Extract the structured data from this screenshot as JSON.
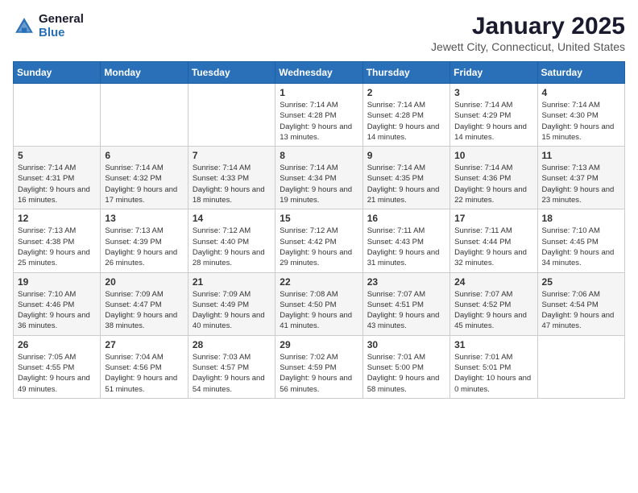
{
  "header": {
    "logo_general": "General",
    "logo_blue": "Blue",
    "month": "January 2025",
    "location": "Jewett City, Connecticut, United States"
  },
  "weekdays": [
    "Sunday",
    "Monday",
    "Tuesday",
    "Wednesday",
    "Thursday",
    "Friday",
    "Saturday"
  ],
  "weeks": [
    [
      null,
      null,
      null,
      {
        "day": "1",
        "sunrise": "7:14 AM",
        "sunset": "4:28 PM",
        "daylight": "9 hours and 13 minutes."
      },
      {
        "day": "2",
        "sunrise": "7:14 AM",
        "sunset": "4:28 PM",
        "daylight": "9 hours and 14 minutes."
      },
      {
        "day": "3",
        "sunrise": "7:14 AM",
        "sunset": "4:29 PM",
        "daylight": "9 hours and 14 minutes."
      },
      {
        "day": "4",
        "sunrise": "7:14 AM",
        "sunset": "4:30 PM",
        "daylight": "9 hours and 15 minutes."
      }
    ],
    [
      {
        "day": "5",
        "sunrise": "7:14 AM",
        "sunset": "4:31 PM",
        "daylight": "9 hours and 16 minutes."
      },
      {
        "day": "6",
        "sunrise": "7:14 AM",
        "sunset": "4:32 PM",
        "daylight": "9 hours and 17 minutes."
      },
      {
        "day": "7",
        "sunrise": "7:14 AM",
        "sunset": "4:33 PM",
        "daylight": "9 hours and 18 minutes."
      },
      {
        "day": "8",
        "sunrise": "7:14 AM",
        "sunset": "4:34 PM",
        "daylight": "9 hours and 19 minutes."
      },
      {
        "day": "9",
        "sunrise": "7:14 AM",
        "sunset": "4:35 PM",
        "daylight": "9 hours and 21 minutes."
      },
      {
        "day": "10",
        "sunrise": "7:14 AM",
        "sunset": "4:36 PM",
        "daylight": "9 hours and 22 minutes."
      },
      {
        "day": "11",
        "sunrise": "7:13 AM",
        "sunset": "4:37 PM",
        "daylight": "9 hours and 23 minutes."
      }
    ],
    [
      {
        "day": "12",
        "sunrise": "7:13 AM",
        "sunset": "4:38 PM",
        "daylight": "9 hours and 25 minutes."
      },
      {
        "day": "13",
        "sunrise": "7:13 AM",
        "sunset": "4:39 PM",
        "daylight": "9 hours and 26 minutes."
      },
      {
        "day": "14",
        "sunrise": "7:12 AM",
        "sunset": "4:40 PM",
        "daylight": "9 hours and 28 minutes."
      },
      {
        "day": "15",
        "sunrise": "7:12 AM",
        "sunset": "4:42 PM",
        "daylight": "9 hours and 29 minutes."
      },
      {
        "day": "16",
        "sunrise": "7:11 AM",
        "sunset": "4:43 PM",
        "daylight": "9 hours and 31 minutes."
      },
      {
        "day": "17",
        "sunrise": "7:11 AM",
        "sunset": "4:44 PM",
        "daylight": "9 hours and 32 minutes."
      },
      {
        "day": "18",
        "sunrise": "7:10 AM",
        "sunset": "4:45 PM",
        "daylight": "9 hours and 34 minutes."
      }
    ],
    [
      {
        "day": "19",
        "sunrise": "7:10 AM",
        "sunset": "4:46 PM",
        "daylight": "9 hours and 36 minutes."
      },
      {
        "day": "20",
        "sunrise": "7:09 AM",
        "sunset": "4:47 PM",
        "daylight": "9 hours and 38 minutes."
      },
      {
        "day": "21",
        "sunrise": "7:09 AM",
        "sunset": "4:49 PM",
        "daylight": "9 hours and 40 minutes."
      },
      {
        "day": "22",
        "sunrise": "7:08 AM",
        "sunset": "4:50 PM",
        "daylight": "9 hours and 41 minutes."
      },
      {
        "day": "23",
        "sunrise": "7:07 AM",
        "sunset": "4:51 PM",
        "daylight": "9 hours and 43 minutes."
      },
      {
        "day": "24",
        "sunrise": "7:07 AM",
        "sunset": "4:52 PM",
        "daylight": "9 hours and 45 minutes."
      },
      {
        "day": "25",
        "sunrise": "7:06 AM",
        "sunset": "4:54 PM",
        "daylight": "9 hours and 47 minutes."
      }
    ],
    [
      {
        "day": "26",
        "sunrise": "7:05 AM",
        "sunset": "4:55 PM",
        "daylight": "9 hours and 49 minutes."
      },
      {
        "day": "27",
        "sunrise": "7:04 AM",
        "sunset": "4:56 PM",
        "daylight": "9 hours and 51 minutes."
      },
      {
        "day": "28",
        "sunrise": "7:03 AM",
        "sunset": "4:57 PM",
        "daylight": "9 hours and 54 minutes."
      },
      {
        "day": "29",
        "sunrise": "7:02 AM",
        "sunset": "4:59 PM",
        "daylight": "9 hours and 56 minutes."
      },
      {
        "day": "30",
        "sunrise": "7:01 AM",
        "sunset": "5:00 PM",
        "daylight": "9 hours and 58 minutes."
      },
      {
        "day": "31",
        "sunrise": "7:01 AM",
        "sunset": "5:01 PM",
        "daylight": "10 hours and 0 minutes."
      },
      null
    ]
  ]
}
